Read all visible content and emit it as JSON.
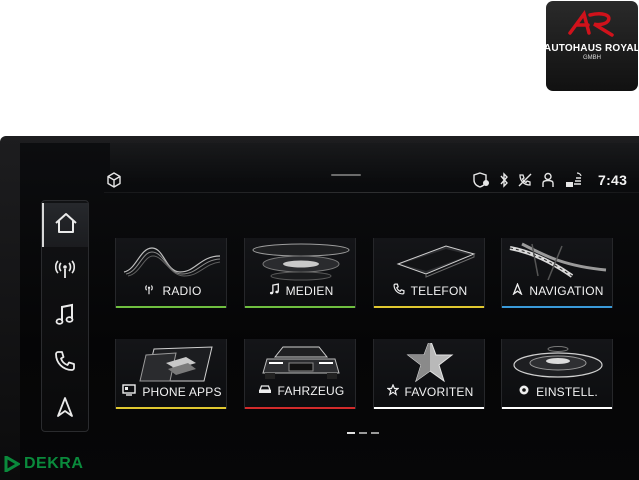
{
  "dealer": {
    "name": "AUTOHAUS ROYAL",
    "sub": "GMBH",
    "mark": "AR",
    "accent": "#d0121b"
  },
  "status": {
    "time": "7:43",
    "icons": [
      "shield-location-icon",
      "bluetooth-icon",
      "phone-muted-icon",
      "user-icon",
      "connectivity-icon"
    ]
  },
  "nav": {
    "items": [
      {
        "name": "home",
        "icon": "home-icon",
        "active": true
      },
      {
        "name": "radio",
        "icon": "antenna-icon"
      },
      {
        "name": "media",
        "icon": "music-note-icon"
      },
      {
        "name": "phone",
        "icon": "phone-icon"
      },
      {
        "name": "navigation",
        "icon": "nav-arrow-icon"
      }
    ]
  },
  "tiles": [
    {
      "id": "radio",
      "label": "RADIO",
      "icon": "antenna-icon",
      "bar_color": "#6fbf40"
    },
    {
      "id": "medien",
      "label": "MEDIEN",
      "icon": "music-note-icon",
      "bar_color": "#6fbf40"
    },
    {
      "id": "telefon",
      "label": "TELEFON",
      "icon": "phone-icon",
      "bar_color": "#e0c830"
    },
    {
      "id": "navigation",
      "label": "NAVIGATION",
      "icon": "nav-arrow-icon",
      "bar_color": "#3a9ad9"
    },
    {
      "id": "phone-apps",
      "label": "PHONE APPS",
      "icon": "phone-apps-icon",
      "bar_color": "#e0c830"
    },
    {
      "id": "fahrzeug",
      "label": "FAHRZEUG",
      "icon": "car-icon",
      "bar_color": "#d22b2b"
    },
    {
      "id": "favoriten",
      "label": "FAVORITEN",
      "icon": "star-icon",
      "bar_color": "#ffffff"
    },
    {
      "id": "einstell",
      "label": "EINSTELL.",
      "icon": "gear-icon",
      "bar_color": "#ffffff"
    }
  ],
  "pager": {
    "pages": 3,
    "current": 1
  },
  "inspection": {
    "name": "DEKRA",
    "color": "#0a8a3c"
  }
}
